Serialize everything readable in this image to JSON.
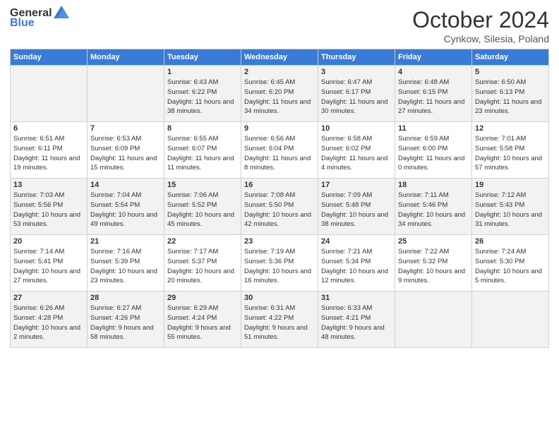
{
  "logo": {
    "text_general": "General",
    "text_blue": "Blue"
  },
  "header": {
    "month": "October 2024",
    "location": "Cynkow, Silesia, Poland"
  },
  "days_of_week": [
    "Sunday",
    "Monday",
    "Tuesday",
    "Wednesday",
    "Thursday",
    "Friday",
    "Saturday"
  ],
  "weeks": [
    [
      {
        "day": "",
        "info": ""
      },
      {
        "day": "",
        "info": ""
      },
      {
        "day": "1",
        "info": "Sunrise: 6:43 AM\nSunset: 6:22 PM\nDaylight: 11 hours and 38 minutes."
      },
      {
        "day": "2",
        "info": "Sunrise: 6:45 AM\nSunset: 6:20 PM\nDaylight: 11 hours and 34 minutes."
      },
      {
        "day": "3",
        "info": "Sunrise: 6:47 AM\nSunset: 6:17 PM\nDaylight: 11 hours and 30 minutes."
      },
      {
        "day": "4",
        "info": "Sunrise: 6:48 AM\nSunset: 6:15 PM\nDaylight: 11 hours and 27 minutes."
      },
      {
        "day": "5",
        "info": "Sunrise: 6:50 AM\nSunset: 6:13 PM\nDaylight: 11 hours and 23 minutes."
      }
    ],
    [
      {
        "day": "6",
        "info": "Sunrise: 6:51 AM\nSunset: 6:11 PM\nDaylight: 11 hours and 19 minutes."
      },
      {
        "day": "7",
        "info": "Sunrise: 6:53 AM\nSunset: 6:09 PM\nDaylight: 11 hours and 15 minutes."
      },
      {
        "day": "8",
        "info": "Sunrise: 6:55 AM\nSunset: 6:07 PM\nDaylight: 11 hours and 11 minutes."
      },
      {
        "day": "9",
        "info": "Sunrise: 6:56 AM\nSunset: 6:04 PM\nDaylight: 11 hours and 8 minutes."
      },
      {
        "day": "10",
        "info": "Sunrise: 6:58 AM\nSunset: 6:02 PM\nDaylight: 11 hours and 4 minutes."
      },
      {
        "day": "11",
        "info": "Sunrise: 6:59 AM\nSunset: 6:00 PM\nDaylight: 11 hours and 0 minutes."
      },
      {
        "day": "12",
        "info": "Sunrise: 7:01 AM\nSunset: 5:58 PM\nDaylight: 10 hours and 57 minutes."
      }
    ],
    [
      {
        "day": "13",
        "info": "Sunrise: 7:03 AM\nSunset: 5:56 PM\nDaylight: 10 hours and 53 minutes."
      },
      {
        "day": "14",
        "info": "Sunrise: 7:04 AM\nSunset: 5:54 PM\nDaylight: 10 hours and 49 minutes."
      },
      {
        "day": "15",
        "info": "Sunrise: 7:06 AM\nSunset: 5:52 PM\nDaylight: 10 hours and 45 minutes."
      },
      {
        "day": "16",
        "info": "Sunrise: 7:08 AM\nSunset: 5:50 PM\nDaylight: 10 hours and 42 minutes."
      },
      {
        "day": "17",
        "info": "Sunrise: 7:09 AM\nSunset: 5:48 PM\nDaylight: 10 hours and 38 minutes."
      },
      {
        "day": "18",
        "info": "Sunrise: 7:11 AM\nSunset: 5:46 PM\nDaylight: 10 hours and 34 minutes."
      },
      {
        "day": "19",
        "info": "Sunrise: 7:12 AM\nSunset: 5:43 PM\nDaylight: 10 hours and 31 minutes."
      }
    ],
    [
      {
        "day": "20",
        "info": "Sunrise: 7:14 AM\nSunset: 5:41 PM\nDaylight: 10 hours and 27 minutes."
      },
      {
        "day": "21",
        "info": "Sunrise: 7:16 AM\nSunset: 5:39 PM\nDaylight: 10 hours and 23 minutes."
      },
      {
        "day": "22",
        "info": "Sunrise: 7:17 AM\nSunset: 5:37 PM\nDaylight: 10 hours and 20 minutes."
      },
      {
        "day": "23",
        "info": "Sunrise: 7:19 AM\nSunset: 5:36 PM\nDaylight: 10 hours and 16 minutes."
      },
      {
        "day": "24",
        "info": "Sunrise: 7:21 AM\nSunset: 5:34 PM\nDaylight: 10 hours and 12 minutes."
      },
      {
        "day": "25",
        "info": "Sunrise: 7:22 AM\nSunset: 5:32 PM\nDaylight: 10 hours and 9 minutes."
      },
      {
        "day": "26",
        "info": "Sunrise: 7:24 AM\nSunset: 5:30 PM\nDaylight: 10 hours and 5 minutes."
      }
    ],
    [
      {
        "day": "27",
        "info": "Sunrise: 6:26 AM\nSunset: 4:28 PM\nDaylight: 10 hours and 2 minutes."
      },
      {
        "day": "28",
        "info": "Sunrise: 6:27 AM\nSunset: 4:26 PM\nDaylight: 9 hours and 58 minutes."
      },
      {
        "day": "29",
        "info": "Sunrise: 6:29 AM\nSunset: 4:24 PM\nDaylight: 9 hours and 55 minutes."
      },
      {
        "day": "30",
        "info": "Sunrise: 6:31 AM\nSunset: 4:22 PM\nDaylight: 9 hours and 51 minutes."
      },
      {
        "day": "31",
        "info": "Sunrise: 6:33 AM\nSunset: 4:21 PM\nDaylight: 9 hours and 48 minutes."
      },
      {
        "day": "",
        "info": ""
      },
      {
        "day": "",
        "info": ""
      }
    ]
  ]
}
